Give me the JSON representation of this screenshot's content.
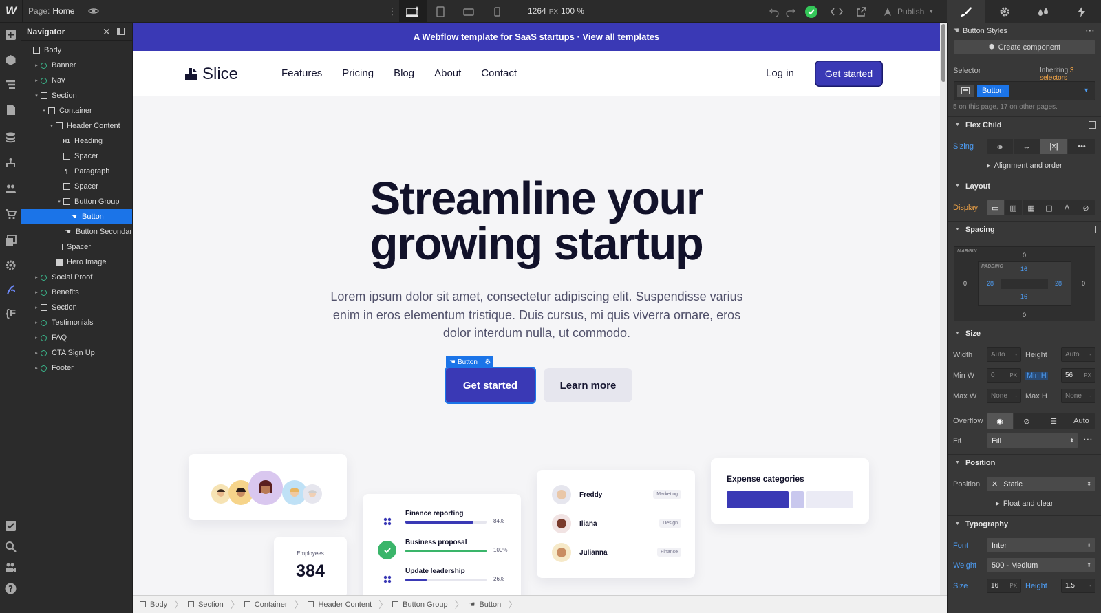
{
  "topbar": {
    "logo": "W",
    "page_prefix": "Page:",
    "page_name": "Home",
    "canvas_width": "1264",
    "width_unit": "PX",
    "zoom": "100 %",
    "publish": "Publish"
  },
  "navigator": {
    "title": "Navigator",
    "items": [
      {
        "label": "Body",
        "depth": 0,
        "icon": "box",
        "caret": ""
      },
      {
        "label": "Banner",
        "depth": 1,
        "icon": "component",
        "caret": "▸"
      },
      {
        "label": "Nav",
        "depth": 1,
        "icon": "component",
        "caret": "▸"
      },
      {
        "label": "Section",
        "depth": 1,
        "icon": "box",
        "caret": "▾"
      },
      {
        "label": "Container",
        "depth": 2,
        "icon": "box",
        "caret": "▾"
      },
      {
        "label": "Header Content",
        "depth": 3,
        "icon": "box",
        "caret": "▾"
      },
      {
        "label": "Heading",
        "depth": 4,
        "icon": "h1",
        "caret": ""
      },
      {
        "label": "Spacer",
        "depth": 4,
        "icon": "box",
        "caret": ""
      },
      {
        "label": "Paragraph",
        "depth": 4,
        "icon": "paragraph",
        "caret": ""
      },
      {
        "label": "Spacer",
        "depth": 4,
        "icon": "box",
        "caret": ""
      },
      {
        "label": "Button Group",
        "depth": 4,
        "icon": "box",
        "caret": "▾"
      },
      {
        "label": "Button",
        "depth": 5,
        "icon": "hand",
        "caret": "",
        "selected": true
      },
      {
        "label": "Button Secondar",
        "depth": 5,
        "icon": "hand",
        "caret": ""
      },
      {
        "label": "Spacer",
        "depth": 3,
        "icon": "box",
        "caret": ""
      },
      {
        "label": "Hero Image",
        "depth": 3,
        "icon": "image",
        "caret": ""
      },
      {
        "label": "Social Proof",
        "depth": 1,
        "icon": "component",
        "caret": "▸"
      },
      {
        "label": "Benefits",
        "depth": 1,
        "icon": "component",
        "caret": "▸"
      },
      {
        "label": "Section",
        "depth": 1,
        "icon": "box",
        "caret": "▸"
      },
      {
        "label": "Testimonials",
        "depth": 1,
        "icon": "component",
        "caret": "▸"
      },
      {
        "label": "FAQ",
        "depth": 1,
        "icon": "component",
        "caret": "▸"
      },
      {
        "label": "CTA Sign Up",
        "depth": 1,
        "icon": "component",
        "caret": "▸"
      },
      {
        "label": "Footer",
        "depth": 1,
        "icon": "component",
        "caret": "▸"
      }
    ]
  },
  "site": {
    "banner": "A Webflow template for SaaS startups · View all templates",
    "brand": "Slice",
    "nav_links": [
      "Features",
      "Pricing",
      "Blog",
      "About",
      "Contact"
    ],
    "login": "Log in",
    "nav_cta": "Get started",
    "hero_line1": "Streamline your",
    "hero_line2": "growing startup",
    "hero_paragraph": "Lorem ipsum dolor sit amet, consectetur adipiscing elit. Suspendisse varius enim in eros elementum tristique. Duis cursus, mi quis viverra ornare, eros dolor interdum nulla, ut commodo.",
    "selected_tag": "Button",
    "primary_button": "Get started",
    "secondary_button": "Learn more",
    "employees_label": "Employees",
    "employees_value": "384",
    "tasks": [
      {
        "name": "Finance reporting",
        "pct": "84%",
        "value": 0.84,
        "color": "#3a39b5",
        "icon": "dots"
      },
      {
        "name": "Business proposal",
        "pct": "100%",
        "value": 1.0,
        "color": "#3ab56a",
        "icon": "check"
      },
      {
        "name": "Update leadership",
        "pct": "26%",
        "value": 0.26,
        "color": "#3a39b5",
        "icon": "dots"
      }
    ],
    "people": [
      {
        "name": "Freddy",
        "tag": "Marketing"
      },
      {
        "name": "Iliana",
        "tag": "Design"
      },
      {
        "name": "Julianna",
        "tag": "Finance"
      }
    ],
    "expense_title": "Expense categories"
  },
  "breadcrumb": [
    "Body",
    "Section",
    "Container",
    "Header Content",
    "Button Group",
    "Button"
  ],
  "panel": {
    "styles_title": "Button Styles",
    "create_component": "Create component",
    "selector_label": "Selector",
    "inheriting_prefix": "Inheriting",
    "inheriting_link": "3 selectors",
    "selector_value": "Button",
    "usage_note": "5 on this page, 17 on other pages.",
    "flex_child": "Flex Child",
    "sizing": "Sizing",
    "alignment": "Alignment and order",
    "layout": "Layout",
    "display": "Display",
    "spacing": "Spacing",
    "margin_label": "MARGIN",
    "padding_label": "PADDING",
    "margin_top": "0",
    "margin_left": "0",
    "margin_right": "0",
    "margin_bottom": "0",
    "padding_top": "16",
    "padding_left": "28",
    "padding_right": "28",
    "padding_bottom": "16",
    "size": "Size",
    "width_label": "Width",
    "width_value": "Auto",
    "height_label": "Height",
    "height_value": "Auto",
    "minw_label": "Min W",
    "minw_value": "0",
    "minw_unit": "PX",
    "minh_label": "Min H",
    "minh_value": "56",
    "minh_unit": "PX",
    "maxw_label": "Max W",
    "maxw_value": "None",
    "maxh_label": "Max H",
    "maxh_value": "None",
    "overflow_label": "Overflow",
    "overflow_auto": "Auto",
    "fit_label": "Fit",
    "fit_value": "Fill",
    "position_section": "Position",
    "position_label": "Position",
    "position_value": "Static",
    "float_clear": "Float and clear",
    "typography": "Typography",
    "font_label": "Font",
    "font_value": "Inter",
    "weight_label": "Weight",
    "weight_value": "500 - Medium",
    "fsize_label": "Size",
    "fsize_value": "16",
    "fsize_unit": "PX",
    "lheight_label": "Height",
    "lheight_value": "1.5"
  },
  "colors": {
    "brand": "#3a39b5",
    "selection": "#1b74e8",
    "success": "#3ab56a"
  }
}
